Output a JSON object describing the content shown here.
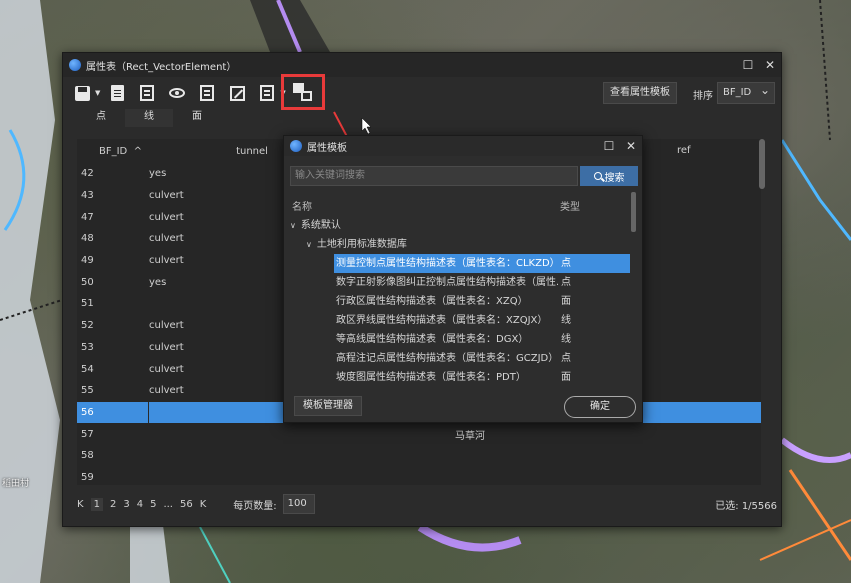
{
  "map": {
    "labels": [
      "稻田村",
      "马草河"
    ]
  },
  "window": {
    "title": "属性表（Rect_VectorElement）",
    "view_template_button": "查看属性模板",
    "sort_label": "排序",
    "sort_value": "BF_ID",
    "tabs": [
      "点",
      "线",
      "面"
    ],
    "active_tab": "线",
    "columns": {
      "id": "BF_ID",
      "tunnel": "tunnel",
      "ref": "ref",
      "sort_arrow": "^"
    },
    "rows": [
      {
        "id": "42",
        "tunnel": "yes",
        "ref": ""
      },
      {
        "id": "43",
        "tunnel": "culvert",
        "ref": ""
      },
      {
        "id": "47",
        "tunnel": "culvert",
        "ref": ""
      },
      {
        "id": "48",
        "tunnel": "culvert",
        "ref": ""
      },
      {
        "id": "49",
        "tunnel": "culvert",
        "ref": ""
      },
      {
        "id": "50",
        "tunnel": "yes",
        "ref": ""
      },
      {
        "id": "51",
        "tunnel": "",
        "ref": ""
      },
      {
        "id": "52",
        "tunnel": "culvert",
        "ref": ""
      },
      {
        "id": "53",
        "tunnel": "culvert",
        "ref": ""
      },
      {
        "id": "54",
        "tunnel": "culvert",
        "ref": ""
      },
      {
        "id": "55",
        "tunnel": "culvert",
        "ref": ""
      },
      {
        "id": "56",
        "tunnel": "",
        "ref": ""
      },
      {
        "id": "57",
        "tunnel": "",
        "ref": "马草河"
      },
      {
        "id": "58",
        "tunnel": "",
        "ref": ""
      },
      {
        "id": "59",
        "tunnel": "",
        "ref": ""
      }
    ],
    "selected_row": "56",
    "pagination": {
      "first": "K",
      "pages": [
        "1",
        "2",
        "3",
        "4",
        "5",
        "...",
        "56"
      ],
      "last": "K",
      "current": "1",
      "per_page_label": "每页数量:",
      "per_page_value": "100",
      "selected_text": "已选: 1/5566"
    }
  },
  "dialog": {
    "title": "属性模板",
    "search_placeholder": "输入关键词搜索",
    "search_button": "搜索",
    "col_name": "名称",
    "col_type": "类型",
    "group": "系统默认",
    "subgroup": "土地利用标准数据库",
    "items": [
      {
        "name": "测量控制点属性结构描述表（属性表名：CLKZD）",
        "type": "点"
      },
      {
        "name": "数字正射影像图纠正控制点属性结构描述表（属性...",
        "type": "点"
      },
      {
        "name": "行政区属性结构描述表（属性表名：XZQ）",
        "type": "面"
      },
      {
        "name": "政区界线属性结构描述表（属性表名：XZQJX）",
        "type": "线"
      },
      {
        "name": "等高线属性结构描述表（属性表名：DGX）",
        "type": "线"
      },
      {
        "name": "高程注记点属性结构描述表（属性表名：GCZJD）",
        "type": "点"
      },
      {
        "name": "坡度图属性结构描述表（属性表名：PDT）",
        "type": "面"
      }
    ],
    "manager_button": "模板管理器",
    "ok_button": "确定"
  },
  "colors": {
    "highlight": "#e83a3a",
    "selection": "#3f8fe0",
    "accent": "#3d6ea5"
  }
}
